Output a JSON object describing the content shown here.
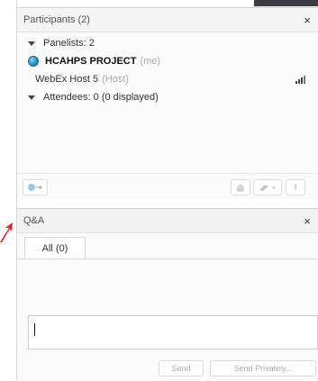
{
  "participants": {
    "header_title": "Participants (2)",
    "close_symbol": "×",
    "panelists_label": "Panelists: 2",
    "project_name": "HCAHPS PROJECT",
    "project_role": "(me)",
    "host_name": "WebEx Host 5",
    "host_role": "(Host)",
    "attendees_label": "Attendees: 0 (0 displayed)",
    "status_icon": "globe-icon",
    "signal_icon": "signal-bars-icon",
    "footer_icons": [
      "share-icon",
      "raise-hand-icon",
      "emoticon-icon",
      "exclamation-icon"
    ],
    "exclaim_symbol": "!"
  },
  "qa": {
    "header_title": "Q&A",
    "close_symbol": "×",
    "tab_all": "All (0)",
    "input_value": "",
    "send_label": "Send",
    "send_privately_label": "Send Privately..."
  },
  "colors": {
    "accent_red": "#e02020",
    "globe_blue": "#2a8fc4",
    "dark_bar": "#3a3d42"
  }
}
